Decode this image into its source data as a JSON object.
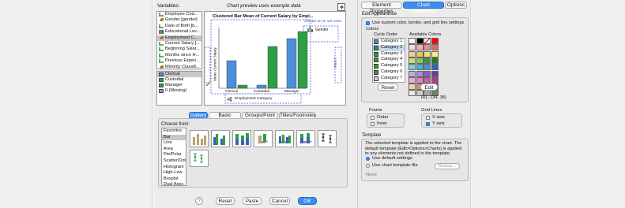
{
  "left": {
    "variables_label": "Variables:",
    "preview_caption": "Chart preview uses example data",
    "variables": [
      {
        "label": "Employee Cod...",
        "kind": "scale"
      },
      {
        "label": "Gender [gender]",
        "kind": "nom"
      },
      {
        "label": "Date of Birth [b...",
        "kind": "scale"
      },
      {
        "label": "Educational Lev...",
        "kind": "ord"
      },
      {
        "label": "Employment C...",
        "kind": "nom",
        "selected": true
      },
      {
        "label": "Current Salary [...",
        "kind": "scale"
      },
      {
        "label": "Beginning Salar...",
        "kind": "scale"
      },
      {
        "label": "Months since H...",
        "kind": "scale"
      },
      {
        "label": "Previous Experi...",
        "kind": "scale"
      },
      {
        "label": "Minority Classifi...",
        "kind": "nom"
      }
    ],
    "categories": [
      {
        "label": "Clerical",
        "color": "#4a8fd8",
        "selected": true
      },
      {
        "label": "Custodial",
        "color": "#2e9e44"
      },
      {
        "label": "Manager",
        "color": "#2e9e44"
      },
      {
        "label": "0 (Missing)",
        "color": "#a58adb"
      }
    ],
    "canvas": {
      "chart_title": "Clustered Bar Mean of Current Salary by Empl...",
      "cluster_label": "Cluster on X: set color",
      "legend_label": "Gender",
      "y_axis_label": "Mean Current Salary",
      "y_axis_prefix": "Mean",
      "filter_label": "Filter?",
      "x_axis_label": "Employment Category",
      "categories": [
        "Clerical",
        "Custodial",
        "Manager"
      ]
    },
    "tabs": [
      "Gallery",
      "Basic Elements",
      "Groups/Point ID",
      "Titles/Footnotes"
    ],
    "choose_from_label": "Choose from:",
    "gallery_types": [
      "Favorites",
      "Bar",
      "Line",
      "Area",
      "Pie/Polar",
      "Scatter/Dot",
      "Histogram",
      "High-Low",
      "Boxplot",
      "Dual Axes"
    ],
    "gallery_selected": "Bar",
    "buttons": {
      "help": "?",
      "reset": "Reset",
      "paste": "Paste",
      "cancel": "Cancel",
      "ok": "OK"
    }
  },
  "right": {
    "tabs": [
      "Element Properties",
      "Chart Appearance",
      "Options"
    ],
    "edit_appearance_label": "Edit Appearance",
    "use_custom_label": "Use custom color, border, and grid line settings",
    "colors_label": "Colors",
    "cycle_order_label": "Cycle Order",
    "available_colors_label": "Available Colors",
    "cycle": [
      {
        "label": "Category 1",
        "color": "#4a8fd8"
      },
      {
        "label": "Category 2",
        "color": "#2e9e44"
      },
      {
        "label": "Category 3",
        "color": "#2e9e44"
      },
      {
        "label": "Category 4",
        "color": "#2e9e44"
      },
      {
        "label": "Category 5",
        "color": "#2e9e44"
      },
      {
        "label": "Category 6",
        "color": "#2e9e44"
      },
      {
        "label": "Category 7",
        "color": "#e8c8e8"
      }
    ],
    "selected_cycle_index": 1,
    "reset_label": "Reset",
    "edit_label": "Edit",
    "rgb_readout": "(41, 134, 38)",
    "palette": [
      "#ffffff",
      "#000000",
      "#ffffff",
      "#ff0000",
      "#f7d9d9",
      "#f5b3b3",
      "#e88f8f",
      "#d96d6d",
      "#f5c89a",
      "#e8c85a",
      "#f0e070",
      "#f0f07a",
      "#c8e070",
      "#88c858",
      "#2e9e44",
      "#207a34",
      "#80d0c8",
      "#4ab0c8",
      "#4a8fd8",
      "#3a62b8",
      "#c0a8e8",
      "#a58adb",
      "#8a5ec8",
      "#6a3ea8",
      "#f0a8d8",
      "#e080c0",
      "#d05aa8",
      "#b03a88",
      "#f0d0b0",
      "#c89870",
      "#a87850",
      "#805030",
      "#e8e8e8",
      "#c8c8c8",
      "#a8a8a8",
      "#787878"
    ],
    "frame_label": "Frame",
    "frame_outer": "Outer",
    "frame_inner": "Inner",
    "grid_lines_label": "Grid Lines",
    "grid_x": "X axis",
    "grid_y": "Y axis",
    "template_label": "Template",
    "template_desc": "The selected template is applied to the chart. The default template (Edit>Options>Charts) is applied to any elements not defined in the template.",
    "use_default": "Use default settings",
    "use_file": "Use chart template file",
    "browse": "Browse...",
    "none": "None"
  }
}
